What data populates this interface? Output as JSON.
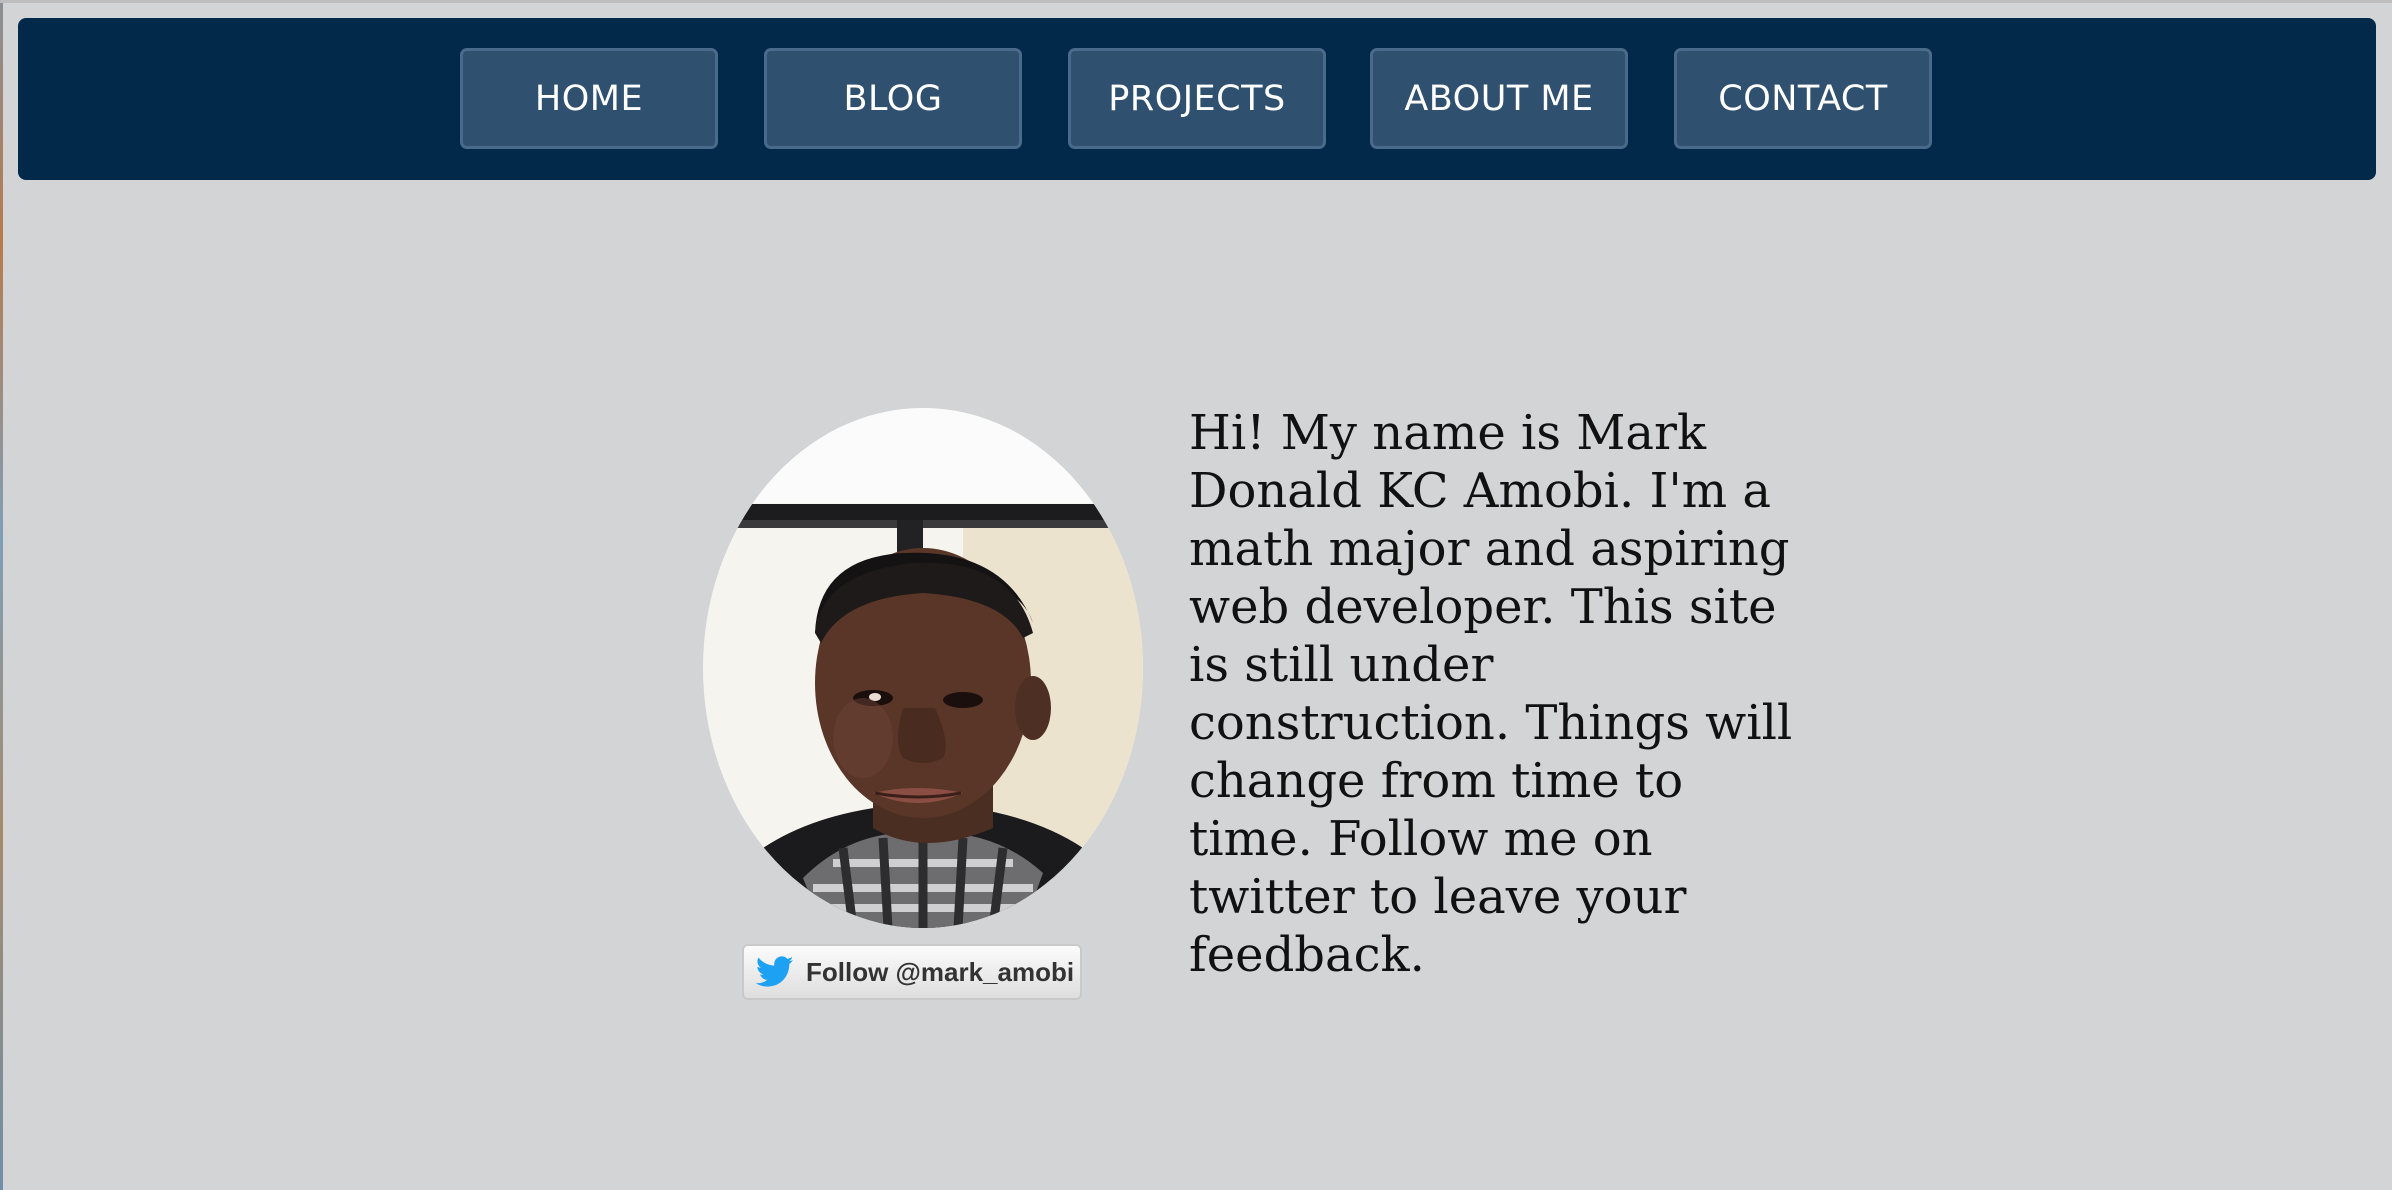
{
  "nav": {
    "items": [
      {
        "label": "HOME"
      },
      {
        "label": "BLOG"
      },
      {
        "label": "PROJECTS"
      },
      {
        "label": "ABOUT ME"
      },
      {
        "label": "CONTACT"
      }
    ]
  },
  "profile": {
    "bio": "Hi! My name is Mark Donald KC Amobi. I'm a math major and aspiring web developer. This site is still under construction. Things will change from time to time. Follow me on twitter to leave your feedback.",
    "follow_label": "Follow @mark_amobi",
    "icon": "twitter-bird-icon"
  },
  "colors": {
    "page_bg": "#d3d4d6",
    "navbar_bg": "#03294a",
    "nav_button_bg": "#30506f",
    "twitter_blue": "#1da1f2"
  }
}
